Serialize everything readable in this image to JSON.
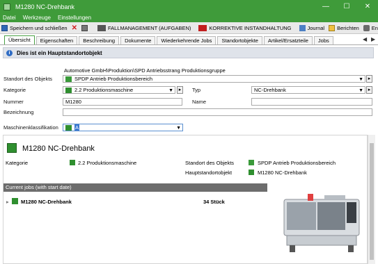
{
  "window": {
    "title": "M1280  NC-Drehbank",
    "minimize": "—",
    "maximize": "☐",
    "close": "✕"
  },
  "menu": {
    "items": [
      "Datei",
      "Werkzeuge",
      "Einstellungen"
    ]
  },
  "toolbar": {
    "save_close": "Speichern und schließen",
    "case_management": "FALLMANAGEMENT (AUFGABEN)",
    "corrective": "KORREKTIVE INSTANDHALTUNG",
    "journal": "Journal",
    "reports": "Berichten",
    "withdrawal": "Entnahme"
  },
  "tabs": [
    "Übersicht",
    "Eigenschaften",
    "Beschreibung",
    "Dokumente",
    "Wiederkehrende Jobs",
    "Standortobjekte",
    "Artikel/Ersatzteile",
    "Jobs"
  ],
  "tab_nav": {
    "prev": "◀",
    "next": "▶"
  },
  "info": {
    "icon": "i",
    "text": "Dies ist ein Hauptstandortobjekt"
  },
  "form": {
    "path": "Automotive GmbH\\Produktion\\SPD Antriebsstrang Produktionsgruppe",
    "location_label": "Standort des Objekts",
    "location_value": "SPDP Antrieb Produktionsbereich",
    "category_label": "Kategorie",
    "category_value": "2.2 Produktionsmaschine",
    "type_label": "Typ",
    "type_value": "NC-Drehbank",
    "number_label": "Nummer",
    "number_value": "M1280",
    "name_label": "Name",
    "name_value": "",
    "designation_label": "Bezeichnung",
    "designation_value": "",
    "classification_label": "Maschinenklassifikation",
    "classification_value": "A"
  },
  "summary": {
    "title": "M1280  NC-Drehbank",
    "category_label": "Kategorie",
    "category_value": "2.2 Produktionsmaschine",
    "location_label": "Standort des Objekts",
    "location_value": "SPDP Antrieb Produktionsbereich",
    "main_label": "Hauptstandortobjekt",
    "main_value": "M1280  NC-Drehbank",
    "jobs_header": "Current jobs (with start date)",
    "job_name": "M1280  NC-Drehbank",
    "job_qty": "34 Stück",
    "expand": "▸"
  },
  "colors": {
    "brand_green": "#3f9b3a",
    "tab_active_border": "#4aa145",
    "jobs_header_bg": "#6d6d6d"
  }
}
